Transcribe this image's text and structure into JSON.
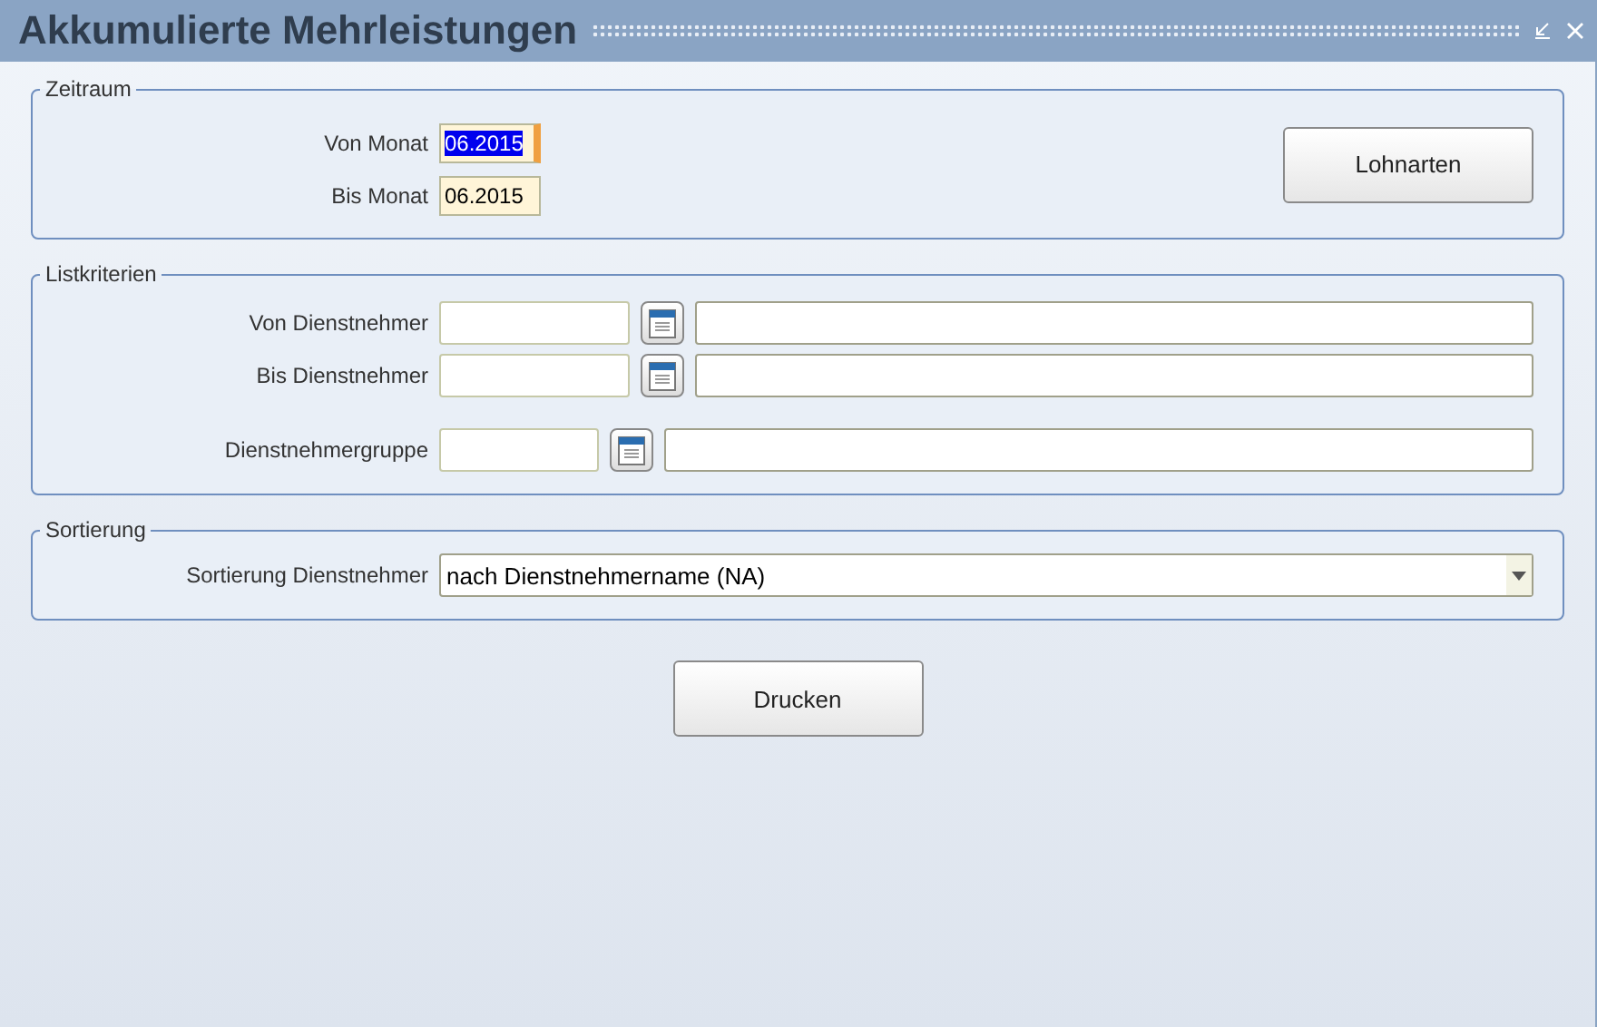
{
  "window": {
    "title": "Akkumulierte Mehrleistungen"
  },
  "zeitraum": {
    "legend": "Zeitraum",
    "fields": [
      {
        "label": "Von Monat",
        "value": "06.2015",
        "focused": true
      },
      {
        "label": "Bis Monat",
        "value": "06.2015",
        "focused": false
      }
    ],
    "button": "Lohnarten"
  },
  "listkriterien": {
    "legend": "Listkriterien",
    "rows": [
      {
        "label": "Von Dienstnehmer",
        "kind": "wide"
      },
      {
        "label": "Bis Dienstnehmer",
        "kind": "wide"
      },
      {
        "label": "Dienstnehmergruppe",
        "kind": "short"
      }
    ]
  },
  "sortierung": {
    "legend": "Sortierung",
    "label": "Sortierung Dienstnehmer",
    "value": "nach Dienstnehmername (NA)"
  },
  "print_button": "Drucken"
}
